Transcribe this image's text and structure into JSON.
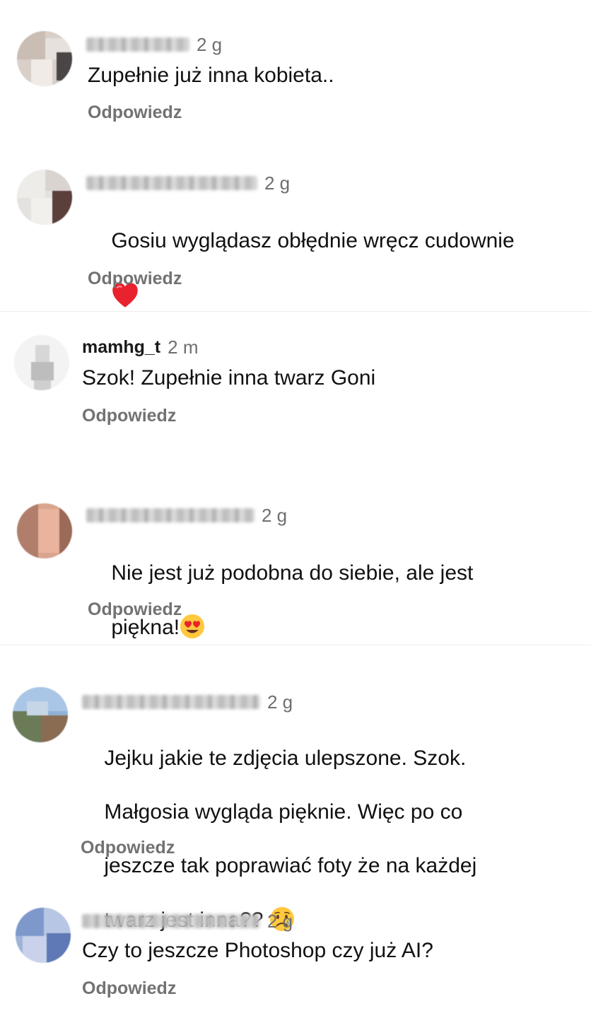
{
  "comments": [
    {
      "username_visible": false,
      "time": "2 g",
      "text": "Zupełnie już inna kobieta..",
      "reply": "Odpowiedz"
    },
    {
      "username_visible": false,
      "time": "2 g",
      "text": "Gosiu wyglądasz obłędnie wręcz cudownie",
      "emoji": "red-heart-icon",
      "reply": "Odpowiedz"
    },
    {
      "username": "mamhg_t",
      "time": "2 m",
      "text": "Szok! Zupełnie inna twarz Goni",
      "reply": "Odpowiedz"
    },
    {
      "username_visible": false,
      "time": "2 g",
      "text_line1": "Nie jest już podobna do siebie, ale jest",
      "text_line2": "piękna!",
      "emoji": "heart-eyes-icon",
      "reply": "Odpowiedz"
    },
    {
      "username_visible": false,
      "time": "2 g",
      "text_line1": "Jejku jakie te zdjęcia ulepszone. Szok.",
      "text_line2": "Małgosia wygląda pięknie. Więc po co",
      "text_line3": "jeszcze tak poprawiać foty że na każdej",
      "text_line4": "twarz jest inna??",
      "emoji": "crying-face-icon",
      "reply": "Odpowiedz"
    },
    {
      "username_visible": false,
      "time": "2 g",
      "text": "Czy to jeszcze Photoshop czy już AI?",
      "reply": "Odpowiedz"
    }
  ],
  "colors": {
    "text": "#111111",
    "secondary": "#6f6f6f",
    "reply": "#727272",
    "divider": "#eeeeee"
  }
}
